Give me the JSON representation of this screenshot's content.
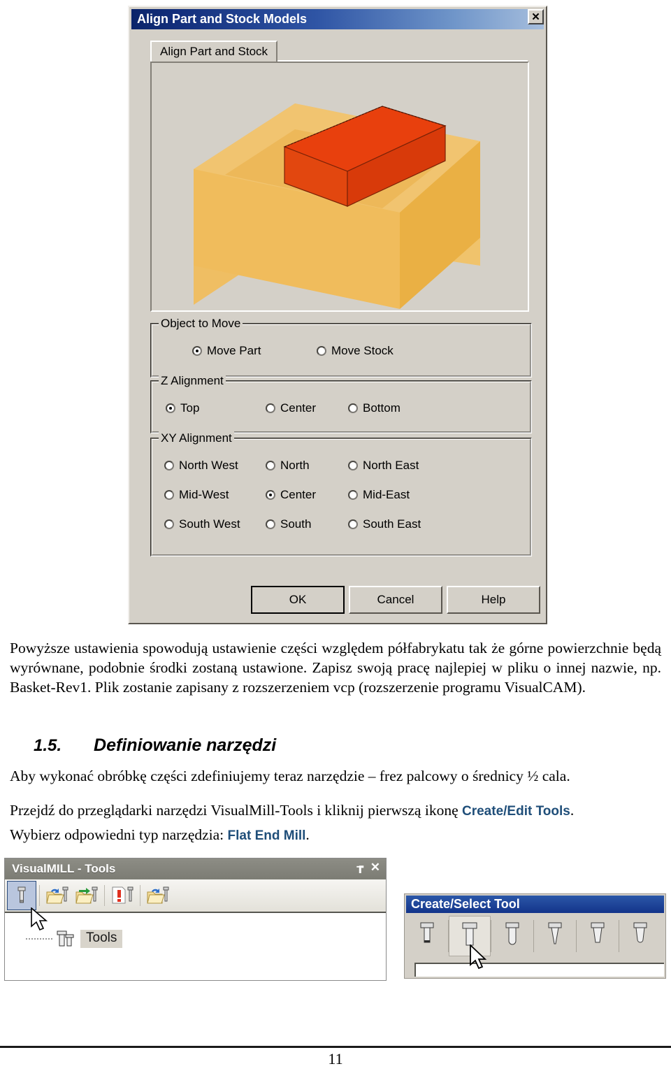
{
  "dialog": {
    "title": "Align Part and Stock Models",
    "close_label": "✕",
    "tab_label": "Align Part and Stock",
    "groups": {
      "object_to_move": {
        "label": "Object to Move",
        "options": [
          {
            "label": "Move Part",
            "selected": true
          },
          {
            "label": "Move Stock",
            "selected": false
          }
        ]
      },
      "z_alignment": {
        "label": "Z Alignment",
        "options": [
          {
            "label": "Top",
            "selected": true
          },
          {
            "label": "Center",
            "selected": false
          },
          {
            "label": "Bottom",
            "selected": false
          }
        ]
      },
      "xy_alignment": {
        "label": "XY Alignment",
        "options": [
          {
            "label": "North West",
            "selected": false
          },
          {
            "label": "North",
            "selected": false
          },
          {
            "label": "North East",
            "selected": false
          },
          {
            "label": "Mid-West",
            "selected": false
          },
          {
            "label": "Center",
            "selected": true
          },
          {
            "label": "Mid-East",
            "selected": false
          },
          {
            "label": "South West",
            "selected": false
          },
          {
            "label": "South",
            "selected": false
          },
          {
            "label": "South East",
            "selected": false
          }
        ]
      }
    },
    "buttons": {
      "ok": "OK",
      "cancel": "Cancel",
      "help": "Help"
    },
    "viewport": {
      "stock_color": "#eeb44f",
      "stock_top_color": "#f0c068",
      "stock_left_color": "#e8a93f",
      "part_color": "#e8400d",
      "part_top_color": "#e43a0c",
      "part_right_color": "#d83a0a",
      "background": "#d4d0c8"
    }
  },
  "body": {
    "para1_a": "Powyższe ustawienia spowodują ustawienie części względem półfabrykatu tak że górne powierzchnie będą wyrównane, podobnie środki zostaną ustawione. Zapisz swoją pracę najlepiej w pliku o innej nazwie, np. Basket-Rev1. Plik zostanie zapisany z rozszerzeniem vcp (rozszerzenie programu VisualCAM).",
    "heading_number": "1.5.",
    "heading_text": "Definiowanie narzędzi",
    "para2": "Aby wykonać obróbkę części zdefiniujemy teraz narzędzie – frez palcowy o średnicy ½ cala.",
    "para3_a": "Przejdź do przeglądarki narzędzi VisualMill-Tools i kliknij pierwszą ikonę ",
    "para3_bold": "Create/Edit Tools",
    "para3_b": ".",
    "para4_a": "Wybierz odpowiedni typ narzędzia: ",
    "para4_bold": "Flat End Mill",
    "para4_b": "."
  },
  "tools_panel": {
    "title": "VisualMILL - Tools",
    "pin_icon": "中",
    "close_icon": "✕",
    "toolbar": [
      {
        "name": "create-edit-tools-icon",
        "selected": true
      },
      {
        "name": "open-tool-library-icon",
        "selected": false
      },
      {
        "name": "import-tools-icon",
        "selected": false
      },
      {
        "name": "tool-info-icon",
        "selected": false
      },
      {
        "name": "load-tools-icon",
        "selected": false
      }
    ],
    "tree_item": "Tools"
  },
  "create_select_tool": {
    "title": "Create/Select Tool",
    "tools": [
      {
        "name": "flat-end-mill-small-icon",
        "selected": false
      },
      {
        "name": "flat-end-mill-icon",
        "selected": true
      },
      {
        "name": "ball-end-mill-icon",
        "selected": false
      },
      {
        "name": "taper-end-mill-icon",
        "selected": false
      },
      {
        "name": "chamfer-mill-icon",
        "selected": false
      },
      {
        "name": "corner-radius-mill-icon",
        "selected": false
      }
    ]
  },
  "footer": {
    "page_number": "11"
  }
}
